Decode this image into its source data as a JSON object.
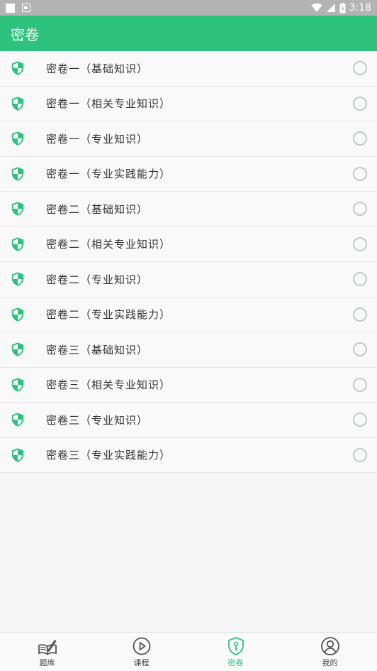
{
  "status_bar": {
    "time": "3:18"
  },
  "app_bar": {
    "title": "密卷"
  },
  "colors": {
    "accent": "#2ec27e",
    "radio": "#c3c8cb"
  },
  "list": {
    "items": [
      {
        "label": "密卷一（基础知识）"
      },
      {
        "label": "密卷一（相关专业知识）"
      },
      {
        "label": "密卷一（专业知识）"
      },
      {
        "label": "密卷一（专业实践能力）"
      },
      {
        "label": "密卷二（基础知识）"
      },
      {
        "label": "密卷二（相关专业知识）"
      },
      {
        "label": "密卷二（专业知识）"
      },
      {
        "label": "密卷二（专业实践能力）"
      },
      {
        "label": "密卷三（基础知识）"
      },
      {
        "label": "密卷三（相关专业知识）"
      },
      {
        "label": "密卷三（专业知识）"
      },
      {
        "label": "密卷三（专业实践能力）"
      }
    ]
  },
  "bottom_nav": {
    "tabs": [
      {
        "label": "题库",
        "icon": "book-pen-icon"
      },
      {
        "label": "课程",
        "icon": "play-circle-icon"
      },
      {
        "label": "密卷",
        "icon": "shield-key-icon",
        "active": true
      },
      {
        "label": "我的",
        "icon": "user-circle-icon"
      }
    ]
  }
}
